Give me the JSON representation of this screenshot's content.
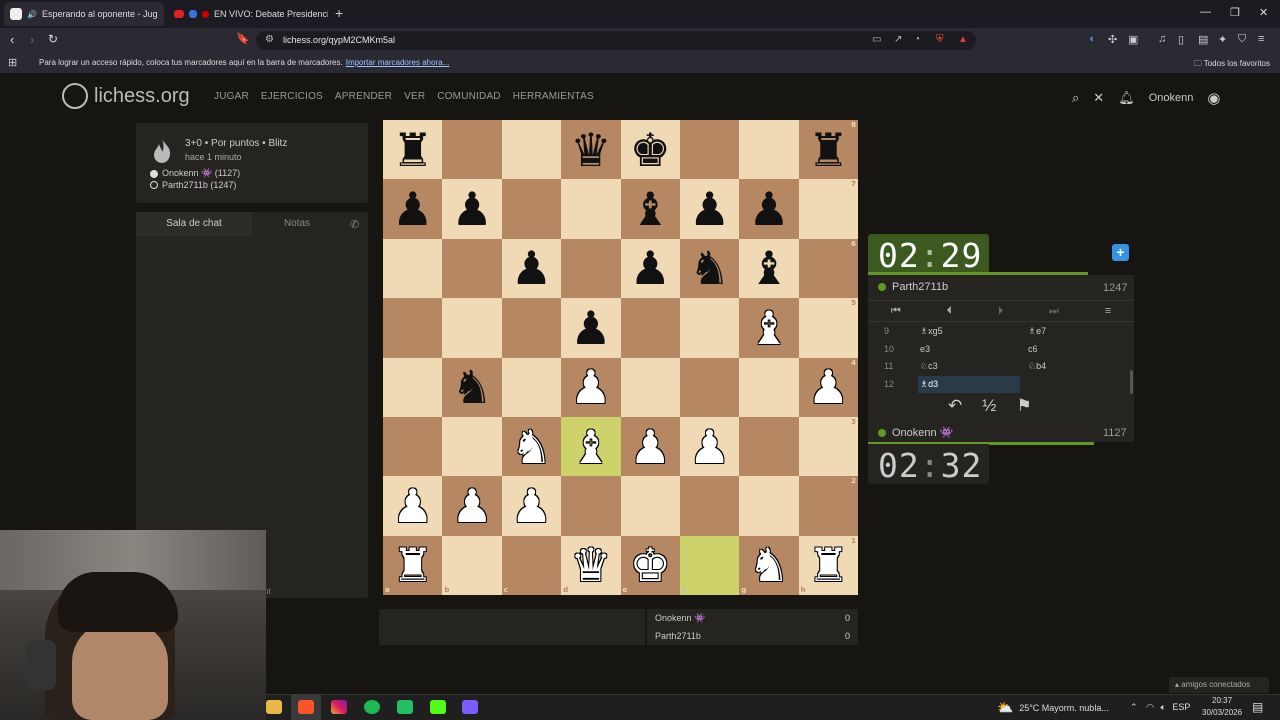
{
  "browser": {
    "tabs": [
      {
        "title": "Esperando al oponente - Jug",
        "active": true
      },
      {
        "title": "EN VIVO: Debate Presidencia",
        "active": false
      }
    ],
    "url": "lichess.org/qypM2CMKm5al",
    "bookmarks_hint": "Para lograr un acceso rápido, coloca tus marcadores aquí en la barra de marcadores.",
    "bookmarks_link": "Importar marcadores ahora...",
    "all_favorites": "Todos los favoritos"
  },
  "site": {
    "logo_text": "lichess.org",
    "menu": [
      "JUGAR",
      "EJERCICIOS",
      "APRENDER",
      "VER",
      "COMUNIDAD",
      "HERRAMIENTAS"
    ],
    "username": "Onokenn"
  },
  "game": {
    "mode": "3+0 • Por puntos • Blitz",
    "time_ago": "hace 1 minuto",
    "white_player": "Onokenn 👾 (1127)",
    "black_player": "Parth2711b (1247)"
  },
  "chat": {
    "chat_tab": "Sala de chat",
    "notes_tab": "Notas",
    "hint": "nt"
  },
  "board": {
    "ranks": [
      [
        "r",
        "",
        "",
        "q",
        "k",
        "",
        "",
        "r"
      ],
      [
        "p",
        "p",
        "",
        "",
        "b",
        "p",
        "p",
        ""
      ],
      [
        "",
        "",
        "p",
        "",
        "p",
        "n",
        "b",
        ""
      ],
      [
        "",
        "",
        "",
        "p",
        "",
        "",
        "B",
        ""
      ],
      [
        "",
        "n",
        "",
        "P",
        "",
        "",
        "",
        "P"
      ],
      [
        "",
        "",
        "N",
        "B",
        "P",
        "P",
        "",
        ""
      ],
      [
        "P",
        "P",
        "P",
        "",
        "",
        "",
        "",
        ""
      ],
      [
        "R",
        "",
        "",
        "Q",
        "K",
        "",
        "N",
        "R"
      ]
    ],
    "highlights": [
      "d3",
      "f1"
    ],
    "files": [
      "a",
      "b",
      "c",
      "d",
      "e",
      "f",
      "g",
      "h"
    ],
    "rank_labels": [
      "8",
      "7",
      "6",
      "5",
      "4",
      "3",
      "2",
      "1"
    ]
  },
  "opponent": {
    "name": "Parth2711b",
    "rating": "1247",
    "clock_min": "02",
    "clock_sec": "29"
  },
  "me": {
    "name": "Onokenn 👾",
    "rating": "1127",
    "clock_min": "02",
    "clock_sec": "32"
  },
  "moves": [
    {
      "num": "9",
      "white": "♗xg5",
      "black": "♗e7"
    },
    {
      "num": "10",
      "white": "e3",
      "black": "c6"
    },
    {
      "num": "11",
      "white": "♘c3",
      "black": "♘b4"
    },
    {
      "num": "12",
      "white": "♗d3",
      "black": ""
    }
  ],
  "actions": {
    "takeback": "↶",
    "draw": "½",
    "resign": "⚑"
  },
  "scores": [
    {
      "name": "Onokenn 👾",
      "value": "0"
    },
    {
      "name": "Parth2711b",
      "value": "0"
    }
  ],
  "friends": "amigos conectados",
  "taskbar": {
    "weather": "25°C  Mayorm. nubla...",
    "lang": "ESP",
    "time": "20:37",
    "date": "30/03/2026"
  },
  "colors": {
    "light_square": "#f0d9b5",
    "dark_square": "#b58863",
    "highlight_light": "#cdd26a",
    "highlight_dark": "#aaa23a",
    "clock_active": "#3c5a20",
    "accent_green": "#629924"
  }
}
